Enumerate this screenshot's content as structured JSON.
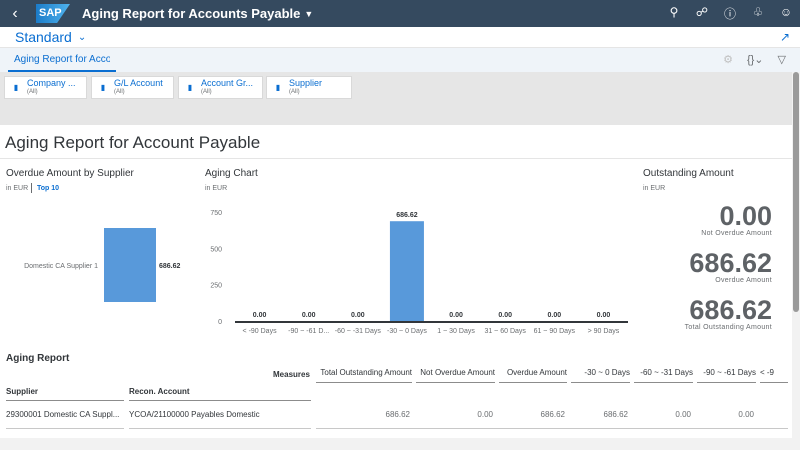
{
  "shell": {
    "logo": "SAP",
    "title": "Aging Report for Accounts Payable",
    "back_icon": "back-arrow-icon",
    "icons": [
      "search-icon",
      "copilot-icon",
      "help-icon",
      "notification-bell-icon",
      "user-icon"
    ]
  },
  "variant": {
    "name": "Standard"
  },
  "tab": {
    "label": "Aging Report for Account Payable"
  },
  "filters": [
    {
      "label": "Company ...",
      "value": "(All)"
    },
    {
      "label": "G/L Account",
      "value": "(All)"
    },
    {
      "label": "Account Gr...",
      "value": "(All)"
    },
    {
      "label": "Supplier",
      "value": "(All)"
    }
  ],
  "page_title": "Aging Report for Account Payable",
  "overdue_card": {
    "title": "Overdue Amount by Supplier",
    "unit": "in EUR",
    "top": "Top 10",
    "bar_label": "Domestic CA Supplier 1",
    "bar_value_label": "686.62"
  },
  "aging_card": {
    "title": "Aging Chart",
    "unit": "in EUR"
  },
  "outstanding_card": {
    "title": "Outstanding Amount",
    "unit": "in EUR",
    "kpis": [
      {
        "value": "0.00",
        "caption": "Not Overdue Amount"
      },
      {
        "value": "686.62",
        "caption": "Overdue Amount"
      },
      {
        "value": "686.62",
        "caption": "Total Outstanding Amount"
      }
    ]
  },
  "chart_data": [
    {
      "type": "bar",
      "title": "Overdue Amount by Supplier",
      "categories": [
        "Domestic CA Supplier 1"
      ],
      "values": [
        686.62
      ],
      "orientation": "horizontal"
    },
    {
      "type": "bar",
      "title": "Aging Chart",
      "categories": [
        "< -90 Days",
        "-90 ~ -61 D...",
        "-60 ~ -31 Days",
        "-30 ~ 0 Days",
        "1 ~ 30 Days",
        "31 ~ 60 Days",
        "61 ~ 90 Days",
        "> 90 Days"
      ],
      "values": [
        0,
        0,
        0,
        686.62,
        0,
        0,
        0,
        0
      ],
      "value_labels": [
        "0.00",
        "0.00",
        "0.00",
        "686.62",
        "0.00",
        "0.00",
        "0.00",
        "0.00"
      ],
      "yticks": [
        "0",
        "250",
        "500",
        "750"
      ],
      "ylim": [
        0,
        750
      ],
      "bar_color": "#5899da"
    }
  ],
  "table": {
    "title": "Aging Report",
    "measures_label": "Measures",
    "dim_headers": [
      "Supplier",
      "Recon. Account"
    ],
    "measure_headers": [
      "Total Outstanding Amount",
      "Not Overdue Amount",
      "Overdue Amount",
      "-30 ~ 0 Days",
      "-60 ~ -31 Days",
      "-90 ~ -61 Days",
      "< -9"
    ],
    "rows": [
      {
        "supplier": "29300001 Domestic CA Suppl...",
        "account": "YCOA/21100000 Payables Domestic",
        "values": [
          "686.62",
          "0.00",
          "686.62",
          "686.62",
          "0.00",
          "0.00"
        ]
      }
    ]
  },
  "colors": {
    "shell": "#354a5f",
    "accent": "#0a6ed1",
    "bar": "#5899da"
  }
}
